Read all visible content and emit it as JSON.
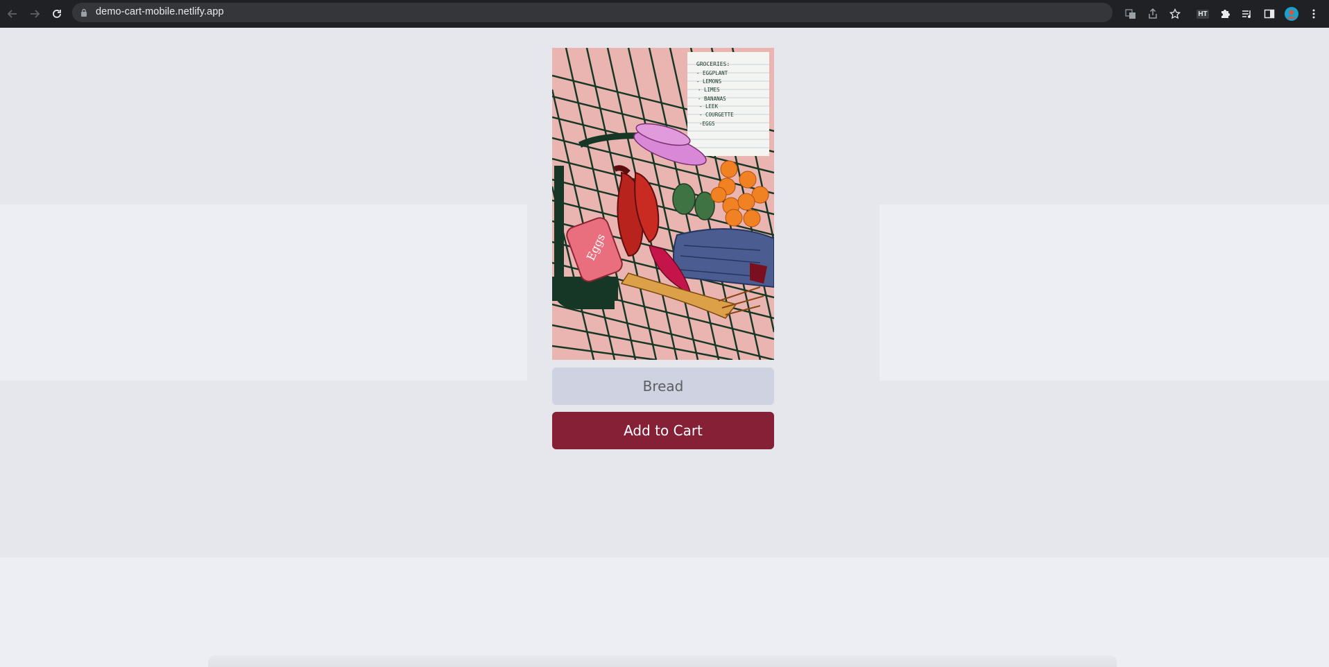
{
  "browser": {
    "url": "demo-cart-mobile.netlify.app",
    "extension_badge": "HT"
  },
  "grocery_list": {
    "title": "GROCERIES:",
    "items": [
      "- EGGPLANT",
      "- LEMONS",
      "- LIMES",
      "- BANANAS",
      "- LEEK",
      "- COURGETTE",
      "-EGGS"
    ]
  },
  "egg_carton_label": "Eggs",
  "product": {
    "name": "Bread",
    "add_to_cart_label": "Add to Cart"
  },
  "colors": {
    "accent": "#852037",
    "field": "#cfd2e0",
    "background": "#e6e7ec"
  }
}
